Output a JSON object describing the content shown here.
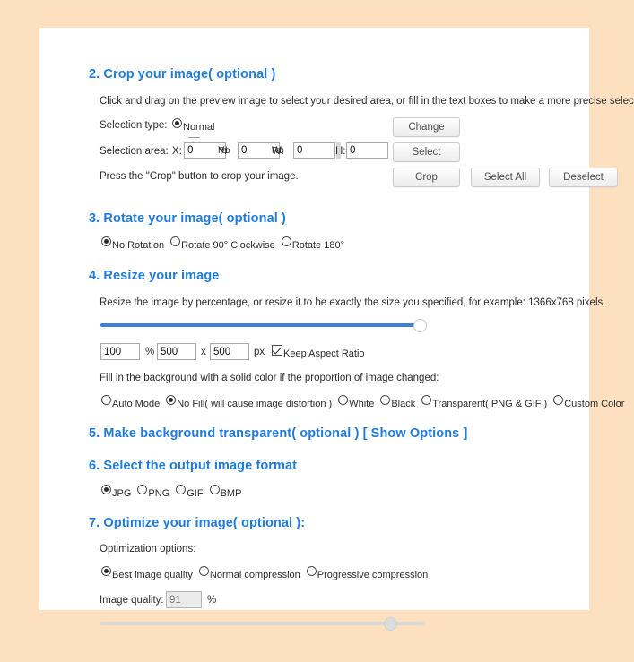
{
  "theme": {
    "page_bg": "#fce0c0",
    "card_bg": "#ffffff",
    "heading_color": "#1f7bdc",
    "slider_fill": "#3f7fd8",
    "slider_track": "#d8d8d8"
  },
  "crop_section": {
    "heading": "2. Crop your image( optional )",
    "description": "Click and drag on the preview image to select your desired area, or fill in the text boxes to make a more precise selection.",
    "selection_type_label": "Selection type:",
    "selection_type_options": [
      {
        "label": "Normal",
        "selected": true
      }
    ],
    "selection_area_label": "Selection area:",
    "fields": [
      {
        "label": "X:",
        "value": "0"
      },
      {
        "label": "Y:",
        "overlap_label": "Ratio",
        "value": "0"
      },
      {
        "label": "W:",
        "overlap_label": "Ratio",
        "value": "0"
      },
      {
        "label": "H:",
        "value": "0"
      }
    ],
    "press_note": "Press the \"Crop\" button to crop your image.",
    "buttons": [
      {
        "label": "Change"
      },
      {
        "label": "Select"
      },
      {
        "label": "Crop"
      },
      {
        "label": "Select All"
      },
      {
        "label": "Deselect"
      }
    ]
  },
  "rotate_section": {
    "heading": "3. Rotate your image( optional )",
    "options": [
      {
        "label": "No Rotation",
        "selected": true
      },
      {
        "label": "Rotate 90° Clockwise",
        "selected": false
      },
      {
        "label": "Rotate 180°",
        "selected": false
      }
    ]
  },
  "resize_section": {
    "heading": "4. Resize your image",
    "description": "Resize the image by percentage, or resize it to be exactly the size you specified, for example: 1366x768 pixels.",
    "slider": {
      "value": 100,
      "min": 0,
      "max": 100
    },
    "percent_value": "100",
    "percent_unit": "%",
    "width_value": "500",
    "times_symbol": "x",
    "height_value": "500",
    "px_unit": "px",
    "keep_aspect_ratio": {
      "label": "Keep Aspect Ratio",
      "checked": true
    },
    "fill_note": "Fill in the background with a solid color if the proportion of image changed:",
    "fill_options": [
      {
        "label": "Auto Mode",
        "selected": false
      },
      {
        "label": "No Fill( will cause image distortion )",
        "selected": true
      },
      {
        "label": "White",
        "selected": false
      },
      {
        "label": "Black",
        "selected": false
      },
      {
        "label": "Transparent( PNG & GIF )",
        "selected": false
      },
      {
        "label": "Custom Color",
        "selected": false
      }
    ]
  },
  "transparent_section": {
    "heading": "5. Make background transparent( optional ) [ Show Options ]"
  },
  "format_section": {
    "heading": "6. Select the output image format",
    "options": [
      {
        "label": "JPG",
        "selected": true
      },
      {
        "label": "PNG",
        "selected": false
      },
      {
        "label": "GIF",
        "selected": false
      },
      {
        "label": "BMP",
        "selected": false
      }
    ]
  },
  "optimize_section": {
    "heading": "7. Optimize your image( optional ):",
    "options_label": "Optimization options:",
    "options": [
      {
        "label": "Best image quality",
        "selected": true
      },
      {
        "label": "Normal compression",
        "selected": false
      },
      {
        "label": "Progressive compression",
        "selected": false
      }
    ],
    "quality_label": "Image quality:",
    "quality_value": "91",
    "quality_unit": "%",
    "quality_slider": {
      "value": 91,
      "min": 0,
      "max": 100
    }
  }
}
